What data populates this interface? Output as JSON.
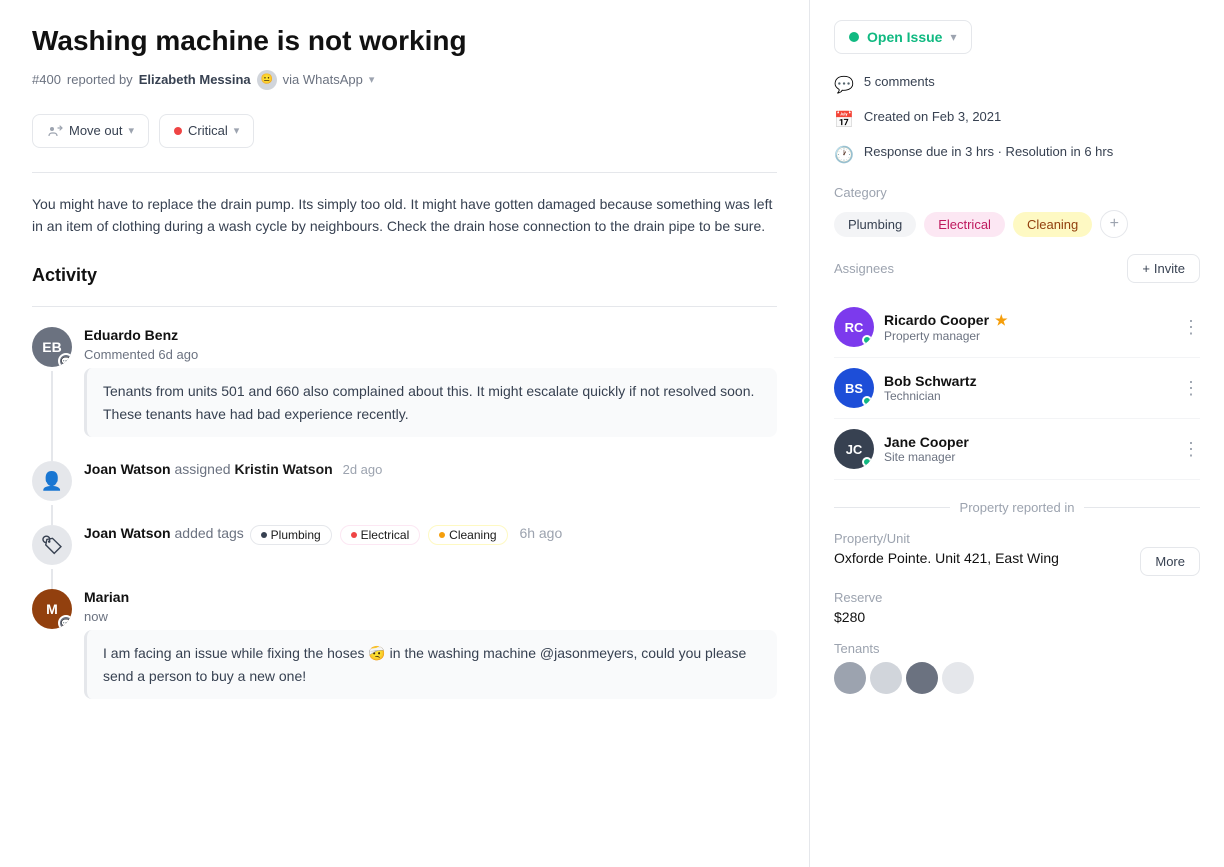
{
  "issue": {
    "title": "Washing machine is not working",
    "number": "#400",
    "reported_by": "Elizabeth Messina",
    "via": "via WhatsApp",
    "description": "You might have to replace the drain pump. Its simply too old. It might have gotten damaged because something was left in an item of clothing during a wash cycle by neighbours. Check the drain hose connection to the drain pipe to be sure."
  },
  "tags": {
    "move_out": "Move out",
    "critical": "Critical"
  },
  "activity": {
    "title": "Activity",
    "comments": [
      {
        "author": "Eduardo Benz",
        "action": "Commented 6d ago",
        "text": "Tenants from units 501 and 660 also complained about this. It might escalate quickly if not resolved soon. These tenants have had bad experience recently.",
        "initials": "EB",
        "color": "av-eduardo"
      }
    ],
    "events": [
      {
        "type": "assign",
        "actor": "Joan Watson",
        "action": "assigned",
        "target": "Kristin Watson",
        "time": "2d ago",
        "icon": "👤"
      },
      {
        "type": "tags",
        "actor": "Joan Watson",
        "action": "added tags",
        "tags": [
          "Plumbing",
          "Electrical",
          "Cleaning"
        ],
        "time": "6h ago",
        "icon": "🏷"
      }
    ],
    "marian": {
      "author": "Marian",
      "action": "now",
      "text": "I am facing an issue while fixing the hoses 🤕 in the washing machine @jasonmeyers, could you please send a person to buy a new one!",
      "initials": "M",
      "color": "av-marian"
    }
  },
  "sidebar": {
    "status": "Open Issue",
    "comments_count": "5 comments",
    "created": "Created on Feb 3, 2021",
    "response": "Response due in 3 hrs · Resolution in 6 hrs",
    "category_label": "Category",
    "categories": [
      "Plumbing",
      "Electrical",
      "Cleaning"
    ],
    "assignees_label": "Assignees",
    "invite_label": "Invite",
    "assignees": [
      {
        "name": "Ricardo Cooper",
        "role": "Property manager",
        "star": true,
        "color": "av-ricardo",
        "initials": "RC"
      },
      {
        "name": "Bob Schwartz",
        "role": "Technician",
        "star": false,
        "color": "av-bob",
        "initials": "BS"
      },
      {
        "name": "Jane Cooper",
        "role": "Site manager",
        "star": false,
        "color": "av-jane",
        "initials": "JC"
      }
    ],
    "property_reported_in": "Property reported in",
    "property_unit_label": "Property/Unit",
    "property_unit_value": "Oxforde Pointe. Unit 421, East Wing",
    "more_label": "More",
    "reserve_label": "Reserve",
    "reserve_value": "$280",
    "tenants_label": "Tenants"
  }
}
